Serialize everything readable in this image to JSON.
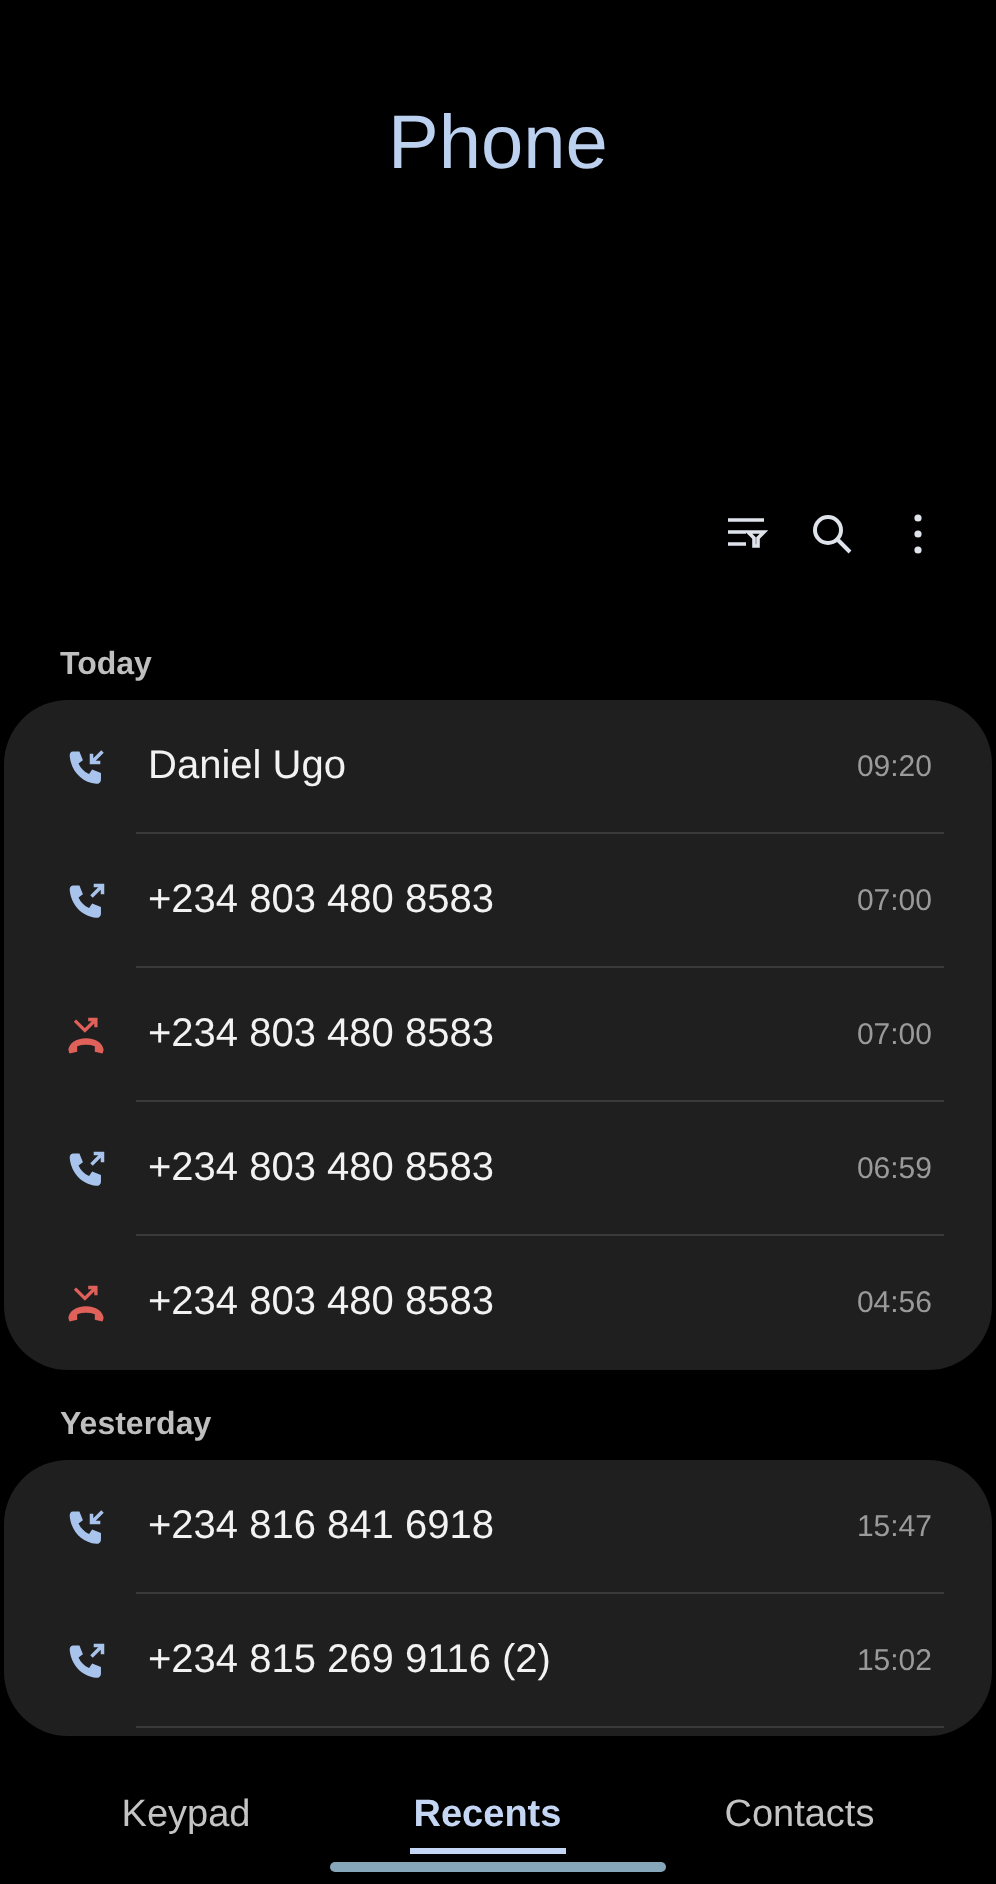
{
  "app": {
    "title": "Phone"
  },
  "sections": [
    {
      "label": "Today",
      "more_below": false,
      "calls": [
        {
          "kind": "incoming",
          "name": "Daniel Ugo",
          "time": "09:20"
        },
        {
          "kind": "outgoing",
          "name": "+234 803 480 8583",
          "time": "07:00"
        },
        {
          "kind": "missed",
          "name": "+234 803 480 8583",
          "time": "07:00"
        },
        {
          "kind": "outgoing",
          "name": "+234 803 480 8583",
          "time": "06:59"
        },
        {
          "kind": "missed",
          "name": "+234 803 480 8583",
          "time": "04:56"
        }
      ]
    },
    {
      "label": "Yesterday",
      "more_below": true,
      "calls": [
        {
          "kind": "incoming",
          "name": "+234 816 841 6918",
          "time": "15:47"
        },
        {
          "kind": "outgoing",
          "name": "+234 815 269 9116 (2)",
          "time": "15:02"
        }
      ]
    }
  ],
  "tabs": [
    {
      "label": "Keypad",
      "selected": false
    },
    {
      "label": "Recents",
      "selected": true
    },
    {
      "label": "Contacts",
      "selected": false
    }
  ]
}
